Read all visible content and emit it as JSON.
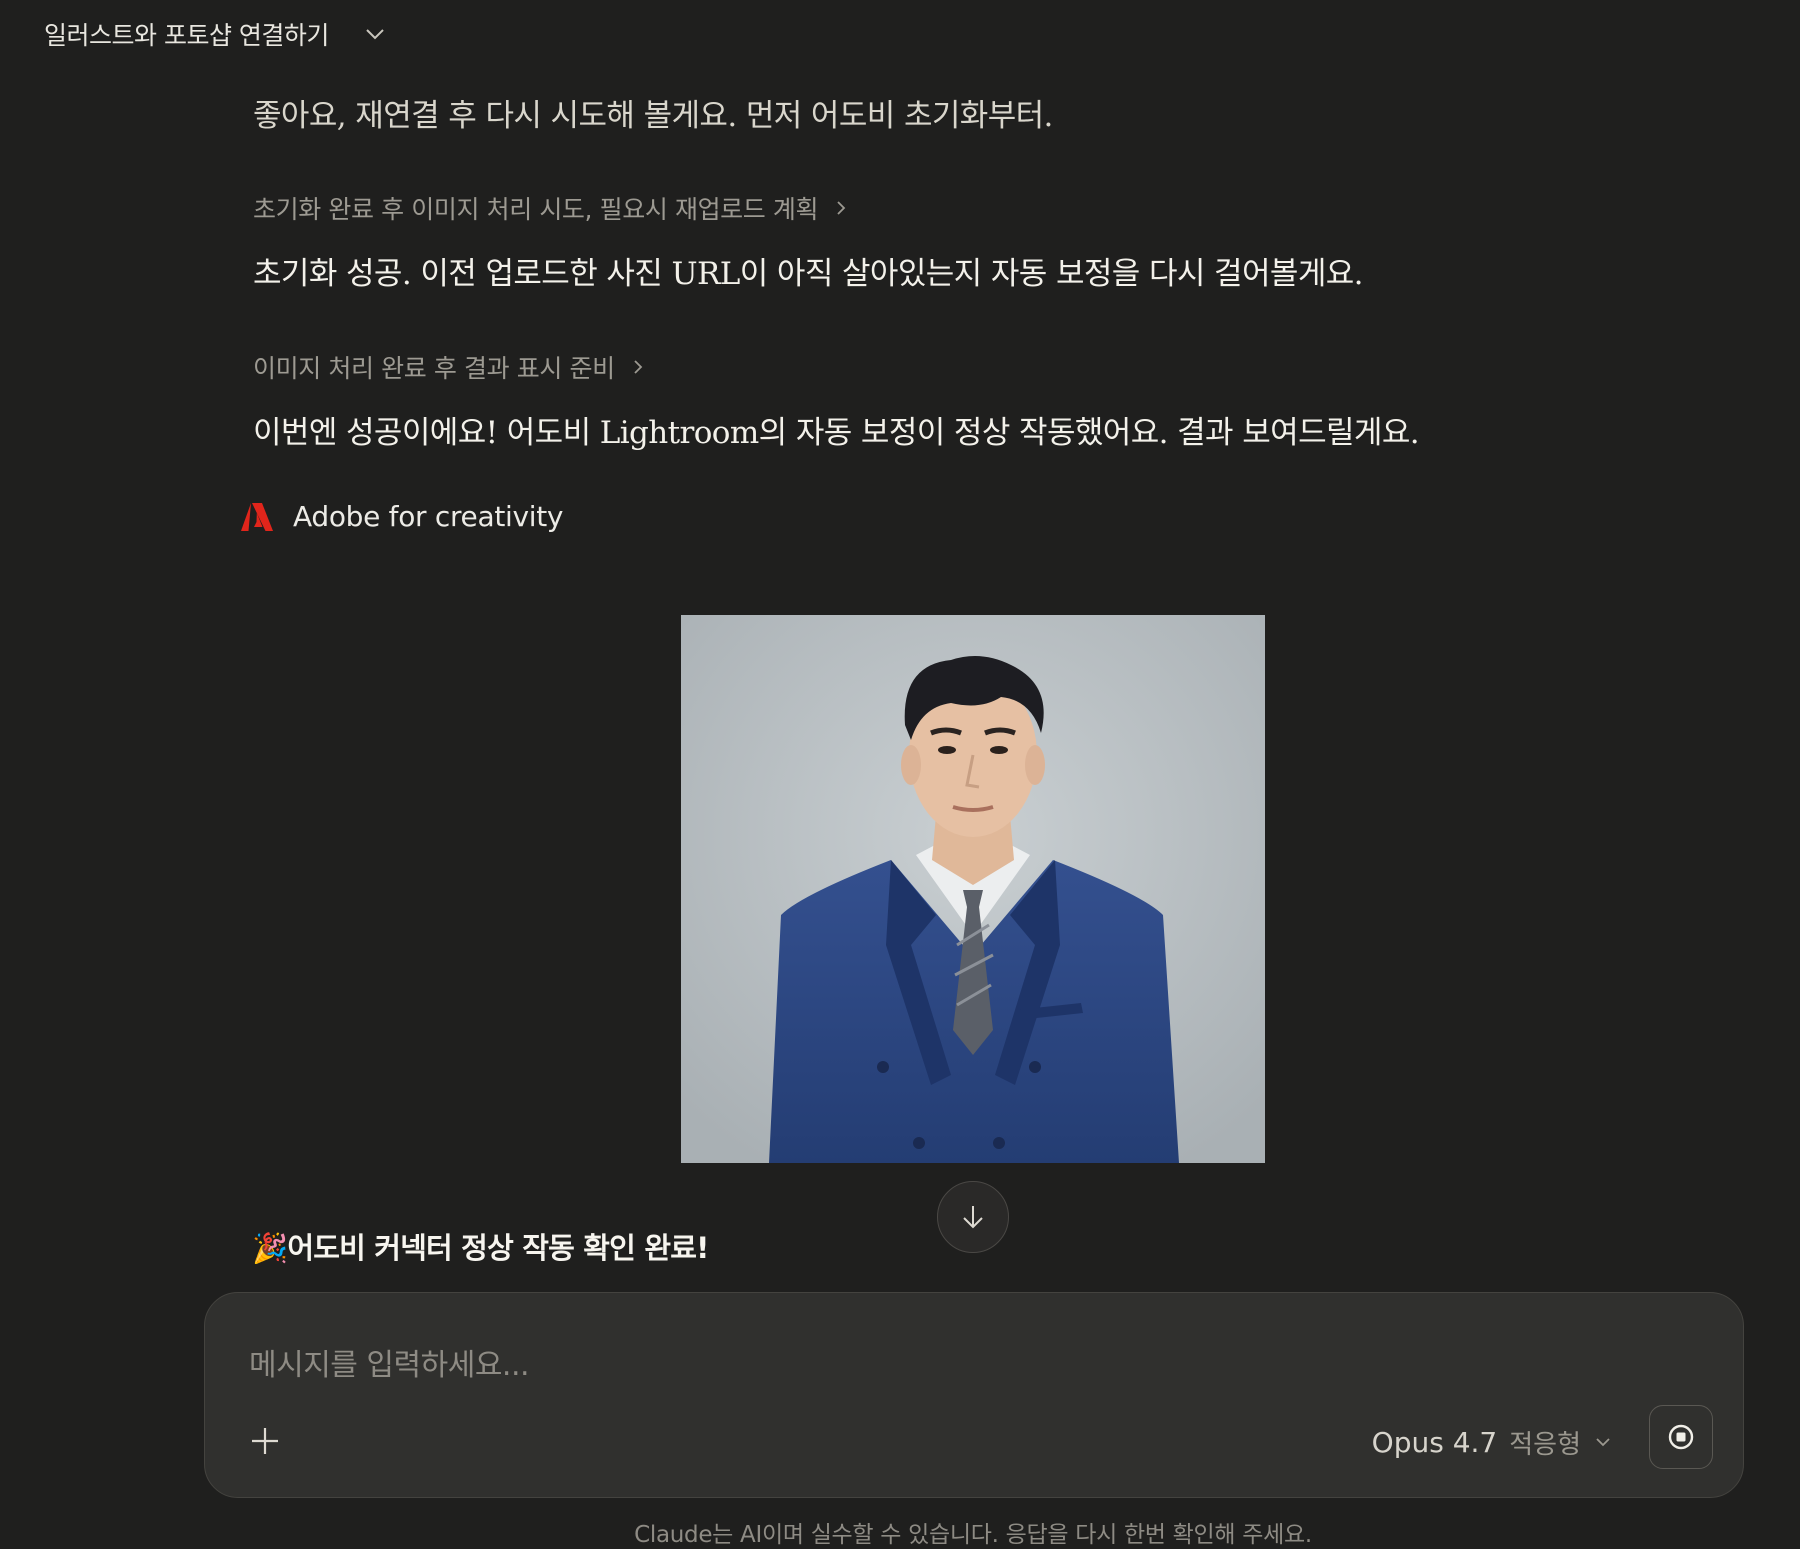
{
  "header": {
    "title": "일러스트와 포토샵 연결하기"
  },
  "messages": {
    "intro": "좋아요, 재연결 후 다시 시도해 볼게요. 먼저 어도비 초기화부터.",
    "thinking1": "초기화 완료 후 이미지 처리 시도, 필요시 재업로드 계획",
    "para2": "초기화 성공. 이전 업로드한 사진 URL이 아직 살아있는지 자동 보정을 다시 걸어볼게요.",
    "thinking2": "이미지 처리 완료 후 결과 표시 준비",
    "para3": "이번엔 성공이에요! 어도비 Lightroom의 자동 보정이 정상 작동했어요. 결과 보여드릴게요.",
    "tool_label": "Adobe for creativity",
    "done_emoji": "🎉",
    "done_text": "어도비 커넥터 정상 작동 확인 완료!"
  },
  "composer": {
    "placeholder": "메시지를 입력하세요...",
    "model": "Opus 4.7",
    "mode": "적응형"
  },
  "footer": {
    "disclaimer": "Claude는 AI이며 실수할 수 있습니다. 응답을 다시 한번 확인해 주세요."
  },
  "icons": {
    "header_chevron": "chevron-down-icon",
    "thinking_chevron": "chevron-right-icon",
    "adobe": "adobe-logo-icon",
    "scroll": "arrow-down-icon",
    "add": "plus-icon",
    "stop": "stop-icon"
  },
  "colors": {
    "background": "#1f1f1e",
    "composer": "#30302e",
    "adobe_red": "#e1251b",
    "suit_blue": "#2f4a86"
  }
}
